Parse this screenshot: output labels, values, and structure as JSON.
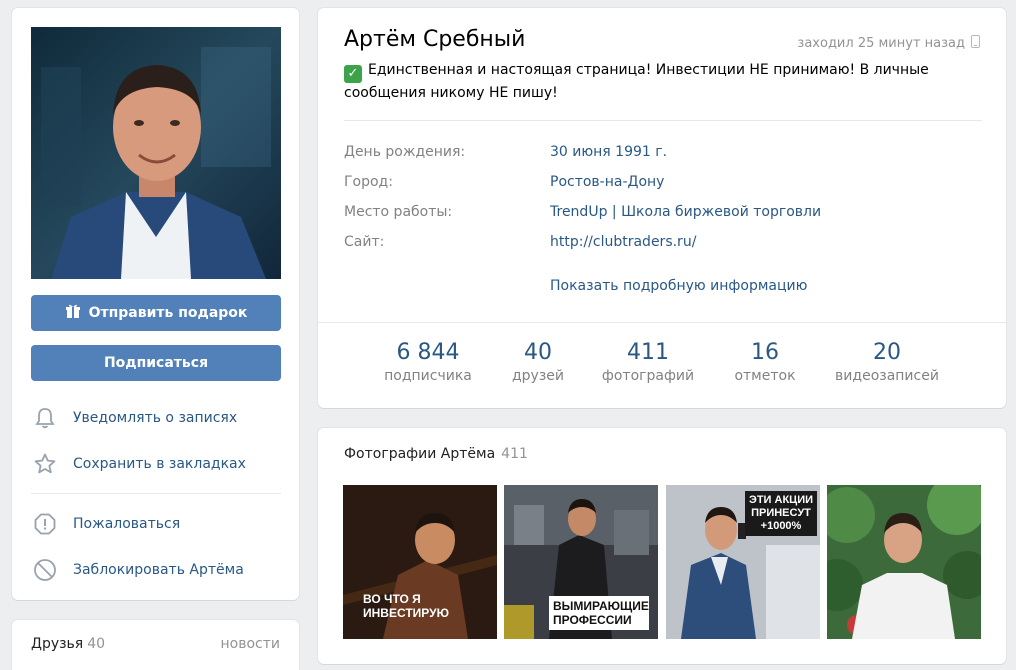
{
  "profile": {
    "name": "Артём Сребный",
    "last_seen": "заходил 25 минут назад",
    "status": "Единственная и настоящая страница! Инвестиции НЕ принимаю! В личные сообщения никому НЕ пишу!",
    "info": [
      {
        "label": "День рождения:",
        "value": "30 июня 1991 г."
      },
      {
        "label": "Город:",
        "value": "Ростов-на-Дону"
      },
      {
        "label": "Место работы:",
        "value": "TrendUp | Школа биржевой торговли"
      },
      {
        "label": "Сайт:",
        "value": "http://clubtraders.ru/"
      }
    ],
    "more_info": "Показать подробную информацию",
    "counters": [
      {
        "num": "6 844",
        "label": "подписчика"
      },
      {
        "num": "40",
        "label": "друзей"
      },
      {
        "num": "411",
        "label": "фотографий"
      },
      {
        "num": "16",
        "label": "отметок"
      },
      {
        "num": "20",
        "label": "видеозаписей"
      }
    ]
  },
  "left": {
    "gift_button": "Отправить подарок",
    "subscribe_button": "Подписаться",
    "actions": [
      {
        "label": "Уведомлять о записях",
        "icon": "bell-icon"
      },
      {
        "label": "Сохранить в закладках",
        "icon": "star-icon"
      },
      {
        "label": "Пожаловаться",
        "icon": "report-icon"
      },
      {
        "label": "Заблокировать Артёма",
        "icon": "block-icon"
      }
    ]
  },
  "friends": {
    "title": "Друзья",
    "count": "40",
    "news": "новости"
  },
  "photos": {
    "title": "Фотографии Артёма",
    "count": "411",
    "items": [
      {
        "caption": "ВО ЧТО Я ИНВЕСТИРУЮ"
      },
      {
        "caption": "ВЫМИРАЮЩИЕ ПРОФЕССИИ"
      },
      {
        "caption": "ЭТИ АКЦИИ ПРИНЕСУТ +1000%"
      },
      {
        "caption": ""
      }
    ]
  },
  "colors": {
    "accent": "#5181b8",
    "link": "#2a5885",
    "background": "#edeef0",
    "check_green": "#3ca34b"
  }
}
